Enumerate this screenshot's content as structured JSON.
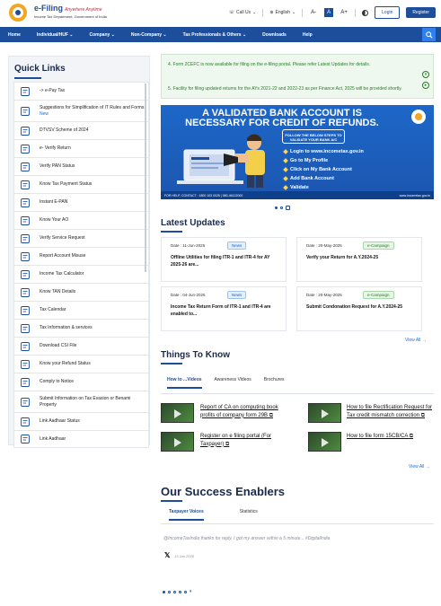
{
  "brand": {
    "title": "e-Filing",
    "tagline": "Anywhere Anytime",
    "subtitle": "Income Tax Department, Government of India"
  },
  "header": {
    "call_us": "Call Us",
    "language": "English",
    "font_small": "A-",
    "font_normal": "A",
    "font_large": "A+",
    "login": "Login",
    "register": "Register"
  },
  "nav": {
    "items": [
      "Home",
      "Individual/HUF",
      "Company",
      "Non-Company",
      "Tax Professionals & Others",
      "Downloads",
      "Help"
    ]
  },
  "quick_links": {
    "title": "Quick Links",
    "items": [
      {
        "label": "-> e-Pay Tax",
        "icon": "epay-icon"
      },
      {
        "label": "Suggestions for Simplification of IT Rules and Forms",
        "new": "New",
        "icon": "suggestion-icon"
      },
      {
        "label": "DTVSV Scheme of 2024",
        "icon": "scheme-icon"
      },
      {
        "label": "e- Verify Return",
        "icon": "verify-return-icon"
      },
      {
        "label": "Verify PAN Status",
        "icon": "pan-status-icon"
      },
      {
        "label": "Know Tax Payment Status",
        "icon": "payment-status-icon"
      },
      {
        "label": "Instant E-PAN",
        "icon": "epan-icon"
      },
      {
        "label": "Know Your AO",
        "icon": "ao-icon"
      },
      {
        "label": "Verify Service Request",
        "icon": "service-request-icon"
      },
      {
        "label": "Report Account Misuse",
        "icon": "misuse-icon"
      },
      {
        "label": "Income Tax Calculator",
        "icon": "calculator-icon"
      },
      {
        "label": "Know TAN Details",
        "icon": "tan-icon"
      },
      {
        "label": "Tax Calendar",
        "icon": "calendar-icon"
      },
      {
        "label": "Tax Information & services",
        "icon": "info-icon"
      },
      {
        "label": "Download CSI File",
        "icon": "download-icon"
      },
      {
        "label": "Know your Refund Status",
        "icon": "refund-icon"
      },
      {
        "label": "Comply to Notice",
        "icon": "notice-icon"
      },
      {
        "label": "Submit Information on Tax Evasion or Benami Property",
        "icon": "evasion-icon"
      },
      {
        "label": "Link Aadhaar Status",
        "icon": "aadhaar-status-icon"
      },
      {
        "label": "Link Aadhaar",
        "icon": "aadhaar-link-icon"
      }
    ]
  },
  "alerts": {
    "items": [
      "4. Form 2CEFC is now available for filing on the e-filing portal. Please refer Latest Updates for details.",
      "5. Facility for filing updated returns for the AYs 2021-22 and 2022-23 as per Finance Act, 2025 will be provided shortly."
    ]
  },
  "banner": {
    "headline": "A VALIDATED BANK ACCOUNT IS NECESSARY FOR CREDIT OF REFUNDS.",
    "follow": "FOLLOW THE BELOW STEPS TO VALIDATE YOUR BANK A/C",
    "steps": [
      "Login to www.incometax.gov.in",
      "Go to My Profile",
      "Click on My Bank Account",
      "Add Bank Account",
      "Validate"
    ],
    "helpdesk": "FOR HELP, CONTACT : 1800 103 0025 | 080-46122000",
    "website": "www.incometax.gov.in"
  },
  "latest_updates": {
    "title": "Latest Updates",
    "cards": [
      {
        "date": "Date : 11-Jun-2025",
        "badge": "News",
        "type": "news",
        "title": "Offline Utilities for filing ITR-1 and ITR-4 for AY 2025-26 are..."
      },
      {
        "date": "Date : 20-May-2025",
        "badge": "e-Campaign",
        "type": "camp",
        "title": "Verify your Return for A.Y.2024-25"
      },
      {
        "date": "Date : 04-Jun-2025",
        "badge": "News",
        "type": "news",
        "title": "Income Tax Return Form of ITR-1 and ITR-4 are enabled to..."
      },
      {
        "date": "Date : 20-May-2025",
        "badge": "e-Campaign",
        "type": "camp",
        "title": "Submit Condonation Request for A.Y.2024-25"
      }
    ],
    "view_all": "View All"
  },
  "things_to_know": {
    "title": "Things To Know",
    "tabs": [
      "How to ...Videos",
      "Awareness Videos",
      "Brochures"
    ],
    "videos": [
      "Report of CA on computing book profits of company form 29B",
      "How to file Rectification Request for Tax credit mismatch correction",
      "Register on e filing portal (For Taxpayer)",
      "How to file form 15CB/CA"
    ],
    "view_all": "View All"
  },
  "success": {
    "title": "Our Success Enablers",
    "tabs": [
      "Taxpayer Voices",
      "Statistics"
    ],
    "tweet": "@IncomeTaxIndia thanks for reply. I got my answer within a 5 minute... #DigitalIndia",
    "tweet_date": "13 Jun 2025"
  },
  "colors": {
    "primary": "#1c4e9c",
    "nav": "#1c4e9c",
    "alert_text": "#2a7a2a"
  }
}
